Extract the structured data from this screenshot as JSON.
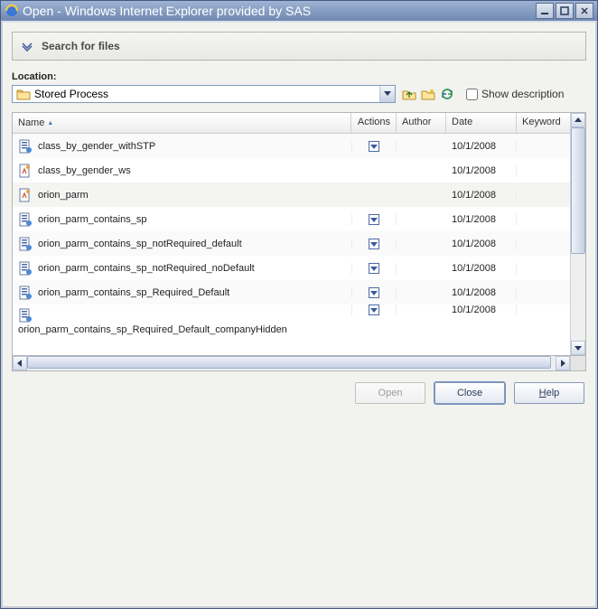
{
  "window": {
    "title": "Open - Windows Internet Explorer provided by SAS"
  },
  "search": {
    "label": "Search for files"
  },
  "location": {
    "label": "Location:",
    "selected": "Stored Process",
    "show_description_label": "Show description"
  },
  "columns": {
    "name": "Name",
    "actions": "Actions",
    "author": "Author",
    "date": "Date",
    "keywords": "Keywords"
  },
  "rows": [
    {
      "icon": "stp",
      "name": "class_by_gender_withSTP",
      "has_action": true,
      "author": "",
      "date": "10/1/2008",
      "keywords": ""
    },
    {
      "icon": "ws",
      "name": "class_by_gender_ws",
      "has_action": false,
      "author": "",
      "date": "10/1/2008",
      "keywords": ""
    },
    {
      "icon": "ws",
      "name": "orion_parm",
      "has_action": false,
      "author": "",
      "date": "10/1/2008",
      "keywords": ""
    },
    {
      "icon": "stp",
      "name": "orion_parm_contains_sp",
      "has_action": true,
      "author": "",
      "date": "10/1/2008",
      "keywords": ""
    },
    {
      "icon": "stp",
      "name": "orion_parm_contains_sp_notRequired_default",
      "has_action": true,
      "author": "",
      "date": "10/1/2008",
      "keywords": ""
    },
    {
      "icon": "stp",
      "name": "orion_parm_contains_sp_notRequired_noDefault",
      "has_action": true,
      "author": "",
      "date": "10/1/2008",
      "keywords": ""
    },
    {
      "icon": "stp",
      "name": "orion_parm_contains_sp_Required_Default",
      "has_action": true,
      "author": "",
      "date": "10/1/2008",
      "keywords": ""
    },
    {
      "icon": "stp",
      "name": "orion_parm_contains_sp_Required_Default_companyHidden",
      "has_action": true,
      "author": "",
      "date": "10/1/2008",
      "keywords": ""
    }
  ],
  "buttons": {
    "open": "Open",
    "close": "Close",
    "help": "Help"
  }
}
